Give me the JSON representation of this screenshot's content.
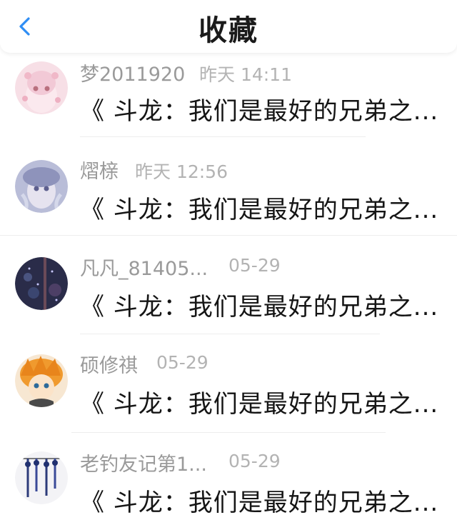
{
  "header": {
    "title": "收藏",
    "back_icon": "chevron-left-icon",
    "accent_color": "#2f8ef4"
  },
  "favorites": [
    {
      "user": "梦2011920",
      "time": "昨天 14:11",
      "post_title": "《 斗龙：我们是最好的兄弟之..."
    },
    {
      "user": "熠榇",
      "time": "昨天 12:56",
      "post_title": "《 斗龙：我们是最好的兄弟之..."
    },
    {
      "user": "凡凡_81405...",
      "time": "05-29",
      "post_title": "《 斗龙：我们是最好的兄弟之..."
    },
    {
      "user": "硕修祺",
      "time": "05-29",
      "post_title": "《 斗龙：我们是最好的兄弟之..."
    },
    {
      "user": "老钓友记第1...",
      "time": "05-29",
      "post_title": "《 斗龙：我们是最好的兄弟之..."
    }
  ]
}
